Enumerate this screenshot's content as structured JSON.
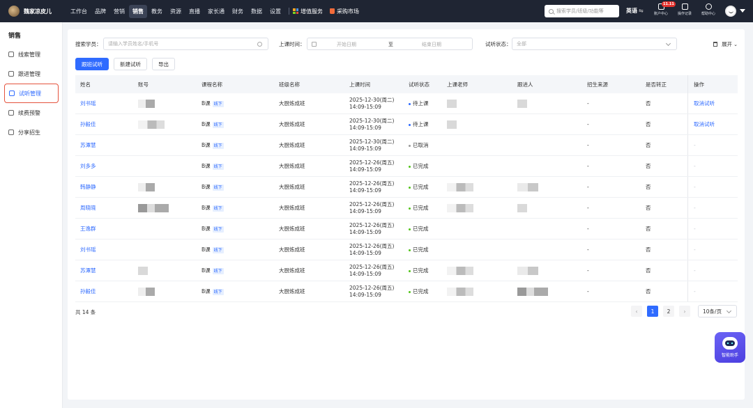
{
  "brand": {
    "name": "魏家凉皮儿"
  },
  "nav": [
    {
      "label": "工作台"
    },
    {
      "label": "品牌"
    },
    {
      "label": "营销"
    },
    {
      "label": "销售",
      "active": true
    },
    {
      "label": "教务"
    },
    {
      "label": "资源"
    },
    {
      "label": "直播"
    },
    {
      "label": "家长通"
    },
    {
      "label": "财务"
    },
    {
      "label": "数据"
    },
    {
      "label": "设置"
    }
  ],
  "nav_special": {
    "value_added": "增值服务",
    "market": "采购市场"
  },
  "top_search": {
    "placeholder": "搜索学员/班级/功能等"
  },
  "lang": {
    "label": "英语",
    "swap": "⇋"
  },
  "tools": {
    "account": "账户中心",
    "account_badge": "11.11",
    "oplog": "操作记录",
    "help": "帮助中心"
  },
  "sidebar": {
    "title": "销售",
    "items": [
      {
        "label": "线索管理"
      },
      {
        "label": "跟进管理"
      },
      {
        "label": "试听管理",
        "active": true
      },
      {
        "label": "续费预警"
      },
      {
        "label": "分享招生"
      }
    ]
  },
  "filters": {
    "student_label": "搜索学员：",
    "student_placeholder": "请输入学员姓名/手机号",
    "time_label": "上课时间：",
    "start_placeholder": "开始日期",
    "to": "至",
    "end_placeholder": "结束日期",
    "status_label": "试听状态：",
    "status_value": "全部",
    "expand": "展开"
  },
  "buttons": {
    "follow_trial": "跟班试听",
    "new_trial": "新建试听",
    "export": "导出"
  },
  "table": {
    "headers": [
      "姓名",
      "账号",
      "课程名称",
      "班级名称",
      "上课时间",
      "试听状态",
      "上课老师",
      "跟进人",
      "招生来源",
      "是否转正",
      "操作"
    ],
    "rows": [
      {
        "name": "刘书瑶",
        "course": "B课",
        "tag": "线下",
        "class": "大厨炼成班",
        "date": "2025-12-30(周二)",
        "time": "14:09-15:09",
        "status": "待上课",
        "status_color": "#2f6bff",
        "source": "-",
        "convert": "否",
        "action": "取消试听"
      },
      {
        "name": "孙毅佳",
        "course": "B课",
        "tag": "线下",
        "class": "大厨炼成班",
        "date": "2025-12-30(周二)",
        "time": "14:09-15:09",
        "status": "待上课",
        "status_color": "#2f6bff",
        "source": "-",
        "convert": "否",
        "action": "取消试听"
      },
      {
        "name": "苏潭慧",
        "course": "B课",
        "tag": "线下",
        "class": "大厨炼成班",
        "date": "2025-12-30(周二)",
        "time": "14:09-15:09",
        "status": "已取消",
        "status_color": "#999999",
        "source": "-",
        "convert": "否",
        "action": "-"
      },
      {
        "name": "刘多多",
        "course": "B课",
        "tag": "线下",
        "class": "大厨炼成班",
        "date": "2025-12-26(周五)",
        "time": "14:09-15:09",
        "status": "已完成",
        "status_color": "#52c41a",
        "source": "-",
        "convert": "否",
        "action": "-"
      },
      {
        "name": "韩静静",
        "course": "B课",
        "tag": "线下",
        "class": "大厨炼成班",
        "date": "2025-12-26(周五)",
        "time": "14:09-15:09",
        "status": "已完成",
        "status_color": "#52c41a",
        "source": "-",
        "convert": "否",
        "action": "-"
      },
      {
        "name": "周晓晓",
        "course": "B课",
        "tag": "线下",
        "class": "大厨炼成班",
        "date": "2025-12-26(周五)",
        "time": "14:09-15:09",
        "status": "已完成",
        "status_color": "#52c41a",
        "source": "-",
        "convert": "否",
        "action": "-"
      },
      {
        "name": "王逸群",
        "course": "B课",
        "tag": "线下",
        "class": "大厨炼成班",
        "date": "2025-12-26(周五)",
        "time": "14:09-15:09",
        "status": "已完成",
        "status_color": "#52c41a",
        "source": "-",
        "convert": "否",
        "action": "-"
      },
      {
        "name": "刘书瑶",
        "course": "B课",
        "tag": "线下",
        "class": "大厨炼成班",
        "date": "2025-12-26(周五)",
        "time": "14:09-15:09",
        "status": "已完成",
        "status_color": "#52c41a",
        "source": "-",
        "convert": "否",
        "action": "-"
      },
      {
        "name": "苏潭慧",
        "course": "B课",
        "tag": "线下",
        "class": "大厨炼成班",
        "date": "2025-12-26(周五)",
        "time": "14:09-15:09",
        "status": "已完成",
        "status_color": "#52c41a",
        "source": "-",
        "convert": "否",
        "action": "-"
      },
      {
        "name": "孙毅佳",
        "course": "B课",
        "tag": "线下",
        "class": "大厨炼成班",
        "date": "2025-12-26(周五)",
        "time": "14:09-15:09",
        "status": "已完成",
        "status_color": "#52c41a",
        "source": "-",
        "convert": "否",
        "action": "-"
      }
    ]
  },
  "pagination": {
    "total": "共 14 条",
    "pages": [
      "1",
      "2"
    ],
    "current": "1",
    "page_size": "10条/页",
    "prev": "‹",
    "next": "›"
  },
  "assistant": {
    "label": "智能助手"
  },
  "colors": {
    "primary": "#2f6bff",
    "topbar": "#1f2533",
    "highlight_border": "#e5533d"
  }
}
